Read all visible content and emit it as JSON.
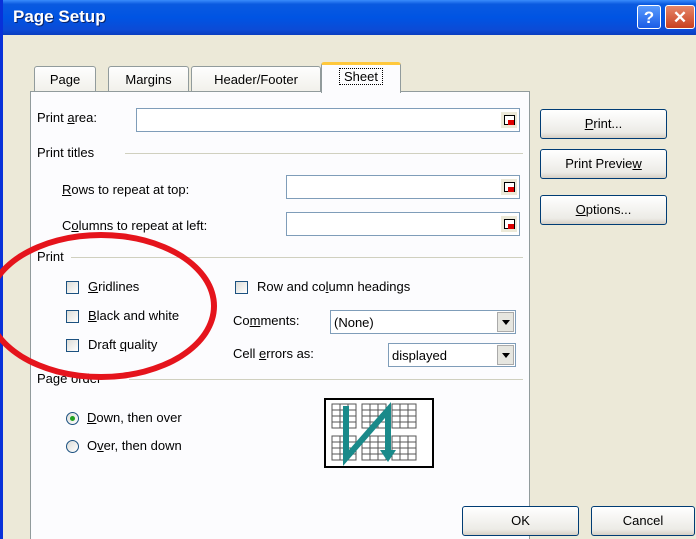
{
  "window": {
    "title": "Page Setup"
  },
  "titlebar": {
    "help_glyph": "?",
    "close_glyph": "✕"
  },
  "tabs": [
    {
      "label": "Page"
    },
    {
      "label": "Margins"
    },
    {
      "label": "Header/Footer"
    },
    {
      "label": "Sheet",
      "active": true
    }
  ],
  "sheet": {
    "print_area": {
      "label_pre": "Print ",
      "label_u": "a",
      "label_post": "rea:",
      "value": ""
    },
    "print_titles": {
      "heading": "Print titles",
      "rows": {
        "label_u": "R",
        "label_post": "ows to repeat at top:",
        "value": ""
      },
      "cols": {
        "label_pre": "C",
        "label_u": "o",
        "label_post": "lumns to repeat at left:",
        "value": ""
      }
    },
    "print": {
      "heading": "Print",
      "gridlines": {
        "label_u": "G",
        "label_post": "ridlines",
        "checked": false
      },
      "black_white": {
        "label_u": "B",
        "label_post": "lack and white",
        "checked": false
      },
      "draft": {
        "label_pre": "Draft ",
        "label_u": "q",
        "label_post": "uality",
        "checked": false
      },
      "row_col_headings": {
        "label_pre": "Row and co",
        "label_u": "l",
        "label_post": "umn headings",
        "checked": false
      },
      "comments": {
        "label_pre": "Co",
        "label_u": "m",
        "label_post": "ments:",
        "value": "(None)"
      },
      "cell_errors": {
        "label_pre": "Cell ",
        "label_u": "e",
        "label_post": "rrors as:",
        "value": "displayed"
      }
    },
    "page_order": {
      "heading": "Page order",
      "down_over": {
        "label_u": "D",
        "label_post": "own, then over",
        "selected": true
      },
      "over_down": {
        "label_pre": "O",
        "label_u": "v",
        "label_post": "er, then down",
        "selected": false
      }
    }
  },
  "buttons": {
    "print": {
      "label_u": "P",
      "label_post": "rint..."
    },
    "print_preview": {
      "label_pre": "Print Previe",
      "label_u": "w"
    },
    "options": {
      "label_u": "O",
      "label_post": "ptions..."
    },
    "ok": "OK",
    "cancel": "Cancel"
  },
  "annotation": {
    "color": "#e5141c"
  },
  "colors": {
    "titlebar": "#0054e3",
    "tab_highlight": "#ffc83c",
    "arrow": "#1a8a8a"
  }
}
